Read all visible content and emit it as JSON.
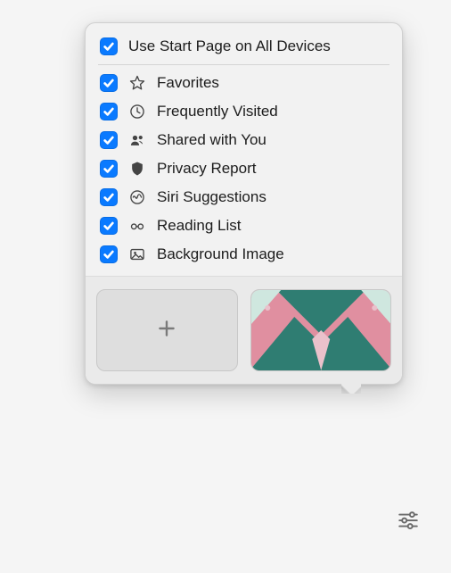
{
  "popover": {
    "header": {
      "label": "Use Start Page on All Devices",
      "checked": true
    },
    "items": [
      {
        "id": "favorites",
        "label": "Favorites",
        "checked": true,
        "icon": "star-icon"
      },
      {
        "id": "frequently-visited",
        "label": "Frequently Visited",
        "checked": true,
        "icon": "clock-icon"
      },
      {
        "id": "shared-with-you",
        "label": "Shared with You",
        "checked": true,
        "icon": "people-icon"
      },
      {
        "id": "privacy-report",
        "label": "Privacy Report",
        "checked": true,
        "icon": "shield-icon"
      },
      {
        "id": "siri-suggestions",
        "label": "Siri Suggestions",
        "checked": true,
        "icon": "siri-icon"
      },
      {
        "id": "reading-list",
        "label": "Reading List",
        "checked": true,
        "icon": "glasses-icon"
      },
      {
        "id": "background-image",
        "label": "Background Image",
        "checked": true,
        "icon": "image-icon"
      }
    ],
    "thumbnails": {
      "add_label": "Add Background",
      "preset_label": "Butterfly Background"
    }
  },
  "colors": {
    "accent": "#0a7aff"
  }
}
